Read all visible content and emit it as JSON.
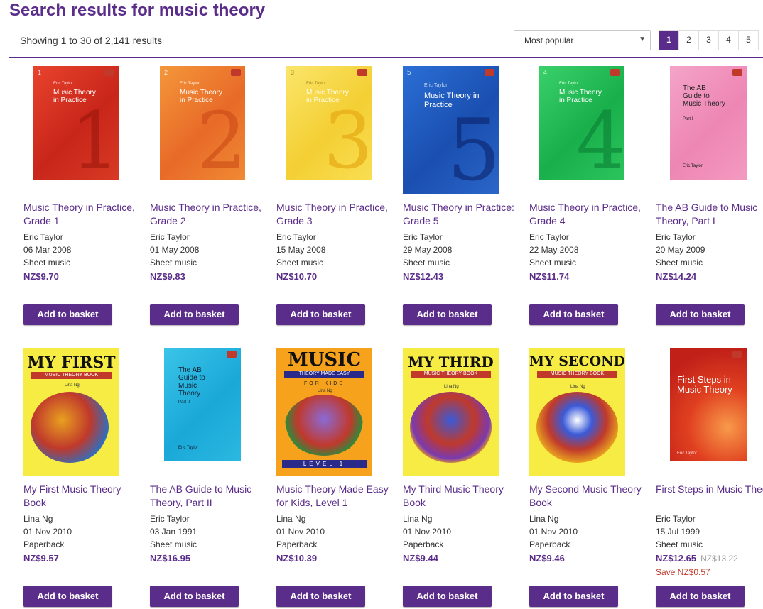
{
  "page": {
    "title": "Search results for music theory",
    "results_text": "Showing 1 to 30 of 2,141 results",
    "sort_value": "Most popular",
    "pages": [
      "1",
      "2",
      "3",
      "4",
      "5"
    ],
    "active_page": "1",
    "add_label": "Add to basket"
  },
  "colors": {
    "accent": "#5b2d8a",
    "sale": "#c0392b"
  },
  "products": [
    {
      "title": "Music Theory in Practice, Grade 1",
      "author": "Eric Taylor",
      "date": "06 Mar 2008",
      "format": "Sheet music",
      "price": "NZ$9.70",
      "cover_title": "Music Theory in Practice",
      "cover_author": "Eric Taylor",
      "cover_number": "1"
    },
    {
      "title": "Music Theory in Practice, Grade 2",
      "author": "Eric Taylor",
      "date": "01 May 2008",
      "format": "Sheet music",
      "price": "NZ$9.83",
      "cover_title": "Music Theory in Practice",
      "cover_author": "Eric Taylor",
      "cover_number": "2"
    },
    {
      "title": "Music Theory in Practice, Grade 3",
      "author": "Eric Taylor",
      "date": "15 May 2008",
      "format": "Sheet music",
      "price": "NZ$10.70",
      "cover_title": "Music Theory in Practice",
      "cover_author": "Eric Taylor",
      "cover_number": "3"
    },
    {
      "title": "Music Theory in Practice: Grade 5",
      "author": "Eric Taylor",
      "date": "29 May 2008",
      "format": "Sheet music",
      "price": "NZ$12.43",
      "cover_title": "Music Theory in Practice",
      "cover_author": "Eric Taylor",
      "cover_number": "5"
    },
    {
      "title": "Music Theory in Practice, Grade 4",
      "author": "Eric Taylor",
      "date": "22 May 2008",
      "format": "Sheet music",
      "price": "NZ$11.74",
      "cover_title": "Music Theory in Practice",
      "cover_author": "Eric Taylor",
      "cover_number": "4"
    },
    {
      "title": "The AB Guide to Music Theory, Part I",
      "author": "Eric Taylor",
      "date": "20 May 2009",
      "format": "Sheet music",
      "price": "NZ$14.24",
      "cover_title": "The AB Guide to Music Theory",
      "cover_author": "Eric Taylor",
      "cover_number": "Part I"
    },
    {
      "title": "My First Music Theory Book",
      "author": "Lina Ng",
      "date": "01 Nov 2010",
      "format": "Paperback",
      "price": "NZ$9.57",
      "cover_title": "MY FIRST",
      "cover_sub": "MUSIC THEORY BOOK",
      "cover_author": "Lina Ng"
    },
    {
      "title": "The AB Guide to Music Theory, Part II",
      "author": "Eric Taylor",
      "date": "03 Jan 1991",
      "format": "Sheet music",
      "price": "NZ$16.95",
      "cover_title": "The AB Guide to Music Theory",
      "cover_author": "Eric Taylor",
      "cover_number": "Part II"
    },
    {
      "title": "Music Theory Made Easy for Kids, Level 1",
      "author": "Lina Ng",
      "date": "01 Nov 2010",
      "format": "Paperback",
      "price": "NZ$10.39",
      "cover_title": "MUSIC",
      "cover_sub": "THEORY MADE EASY",
      "cover_sub2": "FOR KIDS",
      "cover_author": "Lina Ng",
      "cover_number": "LEVEL 1"
    },
    {
      "title": "My Third Music Theory Book",
      "author": "Lina Ng",
      "date": "01 Nov 2010",
      "format": "Paperback",
      "price": "NZ$9.44",
      "cover_title": "MY THIRD",
      "cover_sub": "MUSIC THEORY BOOK",
      "cover_author": "Lina Ng"
    },
    {
      "title": "My Second Music Theory Book",
      "author": "Lina Ng",
      "date": "01 Nov 2010",
      "format": "Paperback",
      "price": "NZ$9.46",
      "cover_title": "MY SECOND",
      "cover_sub": "MUSIC THEORY BOOK",
      "cover_author": "Lina Ng"
    },
    {
      "title": "First Steps in Music Theory",
      "author": "Eric Taylor",
      "date": "15 Jul 1999",
      "format": "Sheet music",
      "price": "NZ$12.65",
      "was_price": "NZ$13.22",
      "save": "Save NZ$0.57",
      "cover_title": "First Steps in Music Theory",
      "cover_author": "Eric Taylor"
    }
  ]
}
